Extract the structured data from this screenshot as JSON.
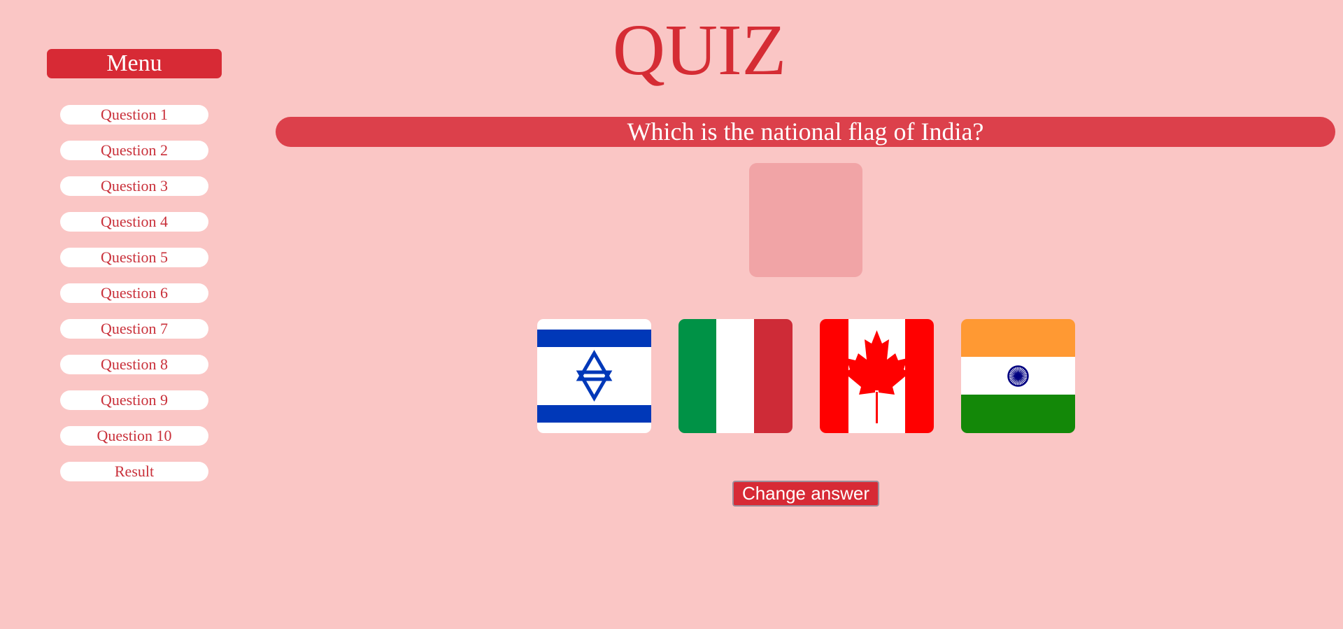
{
  "title": "QUIZ",
  "sidebar": {
    "menu_label": "Menu",
    "items": [
      {
        "label": "Question 1"
      },
      {
        "label": "Question 2"
      },
      {
        "label": "Question 3"
      },
      {
        "label": "Question 4"
      },
      {
        "label": "Question 5"
      },
      {
        "label": "Question 6"
      },
      {
        "label": "Question 7"
      },
      {
        "label": "Question 8"
      },
      {
        "label": "Question 9"
      },
      {
        "label": "Question 10"
      },
      {
        "label": "Result"
      }
    ]
  },
  "question": {
    "text": "Which is the national flag of India?",
    "options": [
      {
        "icon": "israel-flag-icon"
      },
      {
        "icon": "italy-flag-icon"
      },
      {
        "icon": "canada-flag-icon"
      },
      {
        "icon": "india-flag-icon"
      }
    ]
  },
  "actions": {
    "change_answer_label": "Change answer"
  },
  "colors": {
    "background": "#fac6c5",
    "accent": "#d72a35",
    "question_bar": "#dc404b",
    "answer_drop": "#f1a4a6"
  }
}
